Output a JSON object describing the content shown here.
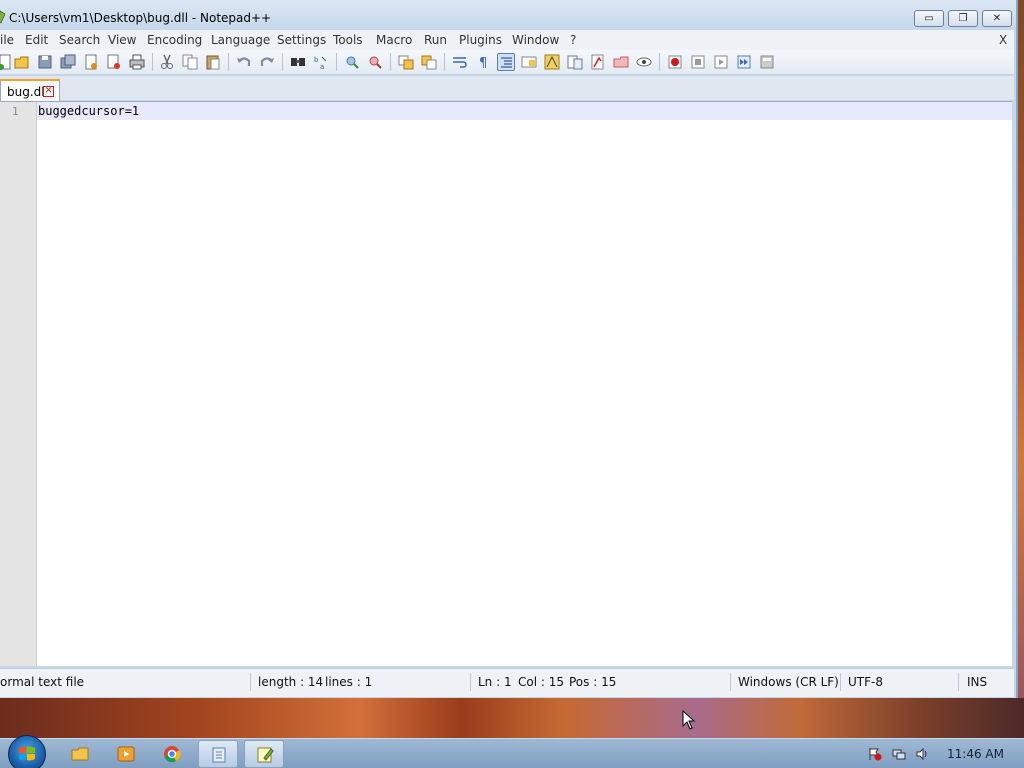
{
  "window": {
    "title": "C:\\Users\\vm1\\Desktop\\bug.dll - Notepad++",
    "min_glyph": "▭",
    "max_glyph": "❐",
    "close_glyph": "✕"
  },
  "menu": {
    "items": [
      "ile",
      "Edit",
      "Search",
      "View",
      "Encoding",
      "Language",
      "Settings",
      "Tools",
      "Macro",
      "Run",
      "Plugins",
      "Window",
      "?"
    ],
    "close_label": "X"
  },
  "toolbar": {
    "icons": [
      "new-file-icon",
      "open-file-icon",
      "save-icon",
      "save-all-icon",
      "close-icon",
      "close-all-icon",
      "print-icon",
      "cut-icon",
      "copy-icon",
      "paste-icon",
      "undo-icon",
      "redo-icon",
      "find-icon",
      "replace-icon",
      "zoom-in-icon",
      "zoom-out-icon",
      "sync-vertical-icon",
      "sync-horizontal-icon",
      "word-wrap-icon",
      "show-all-chars-icon",
      "indent-guide-icon",
      "udl-icon",
      "doc-map-icon",
      "function-list-icon",
      "folder-workspace-icon",
      "monitor-icon",
      "eye-icon",
      "record-macro-icon",
      "stop-macro-icon",
      "play-macro-icon",
      "run-macro-multiple-icon",
      "save-macro-icon"
    ]
  },
  "tabs": [
    {
      "label": "bug.dll",
      "close_glyph": "✕"
    }
  ],
  "editor": {
    "lines": [
      {
        "number": "1",
        "text": "buggedcursor=1"
      }
    ]
  },
  "status": {
    "file_type": "ormal text file",
    "length": "length : 14",
    "lines": "lines : 1",
    "ln": "Ln : 1",
    "col": "Col : 15",
    "pos": "Pos : 15",
    "eol": "Windows (CR LF)",
    "encoding": "UTF-8",
    "mode": "INS"
  },
  "taskbar": {
    "clock": "11:46 AM",
    "apps": [
      "explorer-icon",
      "media-player-icon",
      "chrome-icon",
      "file-app-icon",
      "notepadpp-icon"
    ]
  },
  "colors": {
    "current_line": "#e8e8ff",
    "tab_accent": "#f0a030",
    "close_red": "#cc2222"
  }
}
